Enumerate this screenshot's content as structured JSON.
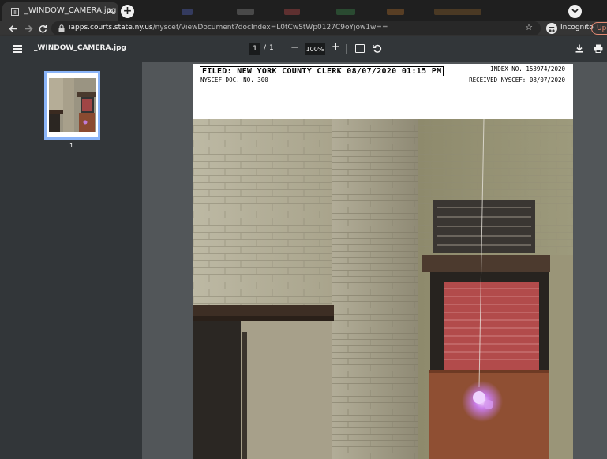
{
  "browser": {
    "tab_title": "_WINDOW_CAMERA.jpg",
    "tab_close": "×",
    "new_tab": "+",
    "url_host": "iapps.courts.state.ny.us",
    "url_path": "/nyscef/ViewDocument?docIndex=L0tCwStWp0127C9oYjow1w==",
    "incognito_label": "Incognito",
    "update_label": "Upd"
  },
  "pdf_toolbar": {
    "doc_title": "_WINDOW_CAMERA.jpg",
    "current_page": "1",
    "page_separator": "/",
    "total_pages": "1",
    "zoom": "100%",
    "zoom_out": "−",
    "zoom_in": "+"
  },
  "sidebar": {
    "thumbnail_label": "1"
  },
  "document": {
    "filed_stamp": "FILED: NEW YORK COUNTY CLERK 08/07/2020 01:15 PM",
    "index_no": "INDEX NO. 153974/2020",
    "nyscef_doc_no": "NYSCEF DOC. NO. 300",
    "received": "RECEIVED NYSCEF: 08/07/2020"
  },
  "icons": {
    "menu": "hamburger-icon",
    "download": "download-icon",
    "print": "print-icon",
    "rotate": "rotate-icon",
    "fit": "fit-to-page-icon"
  }
}
